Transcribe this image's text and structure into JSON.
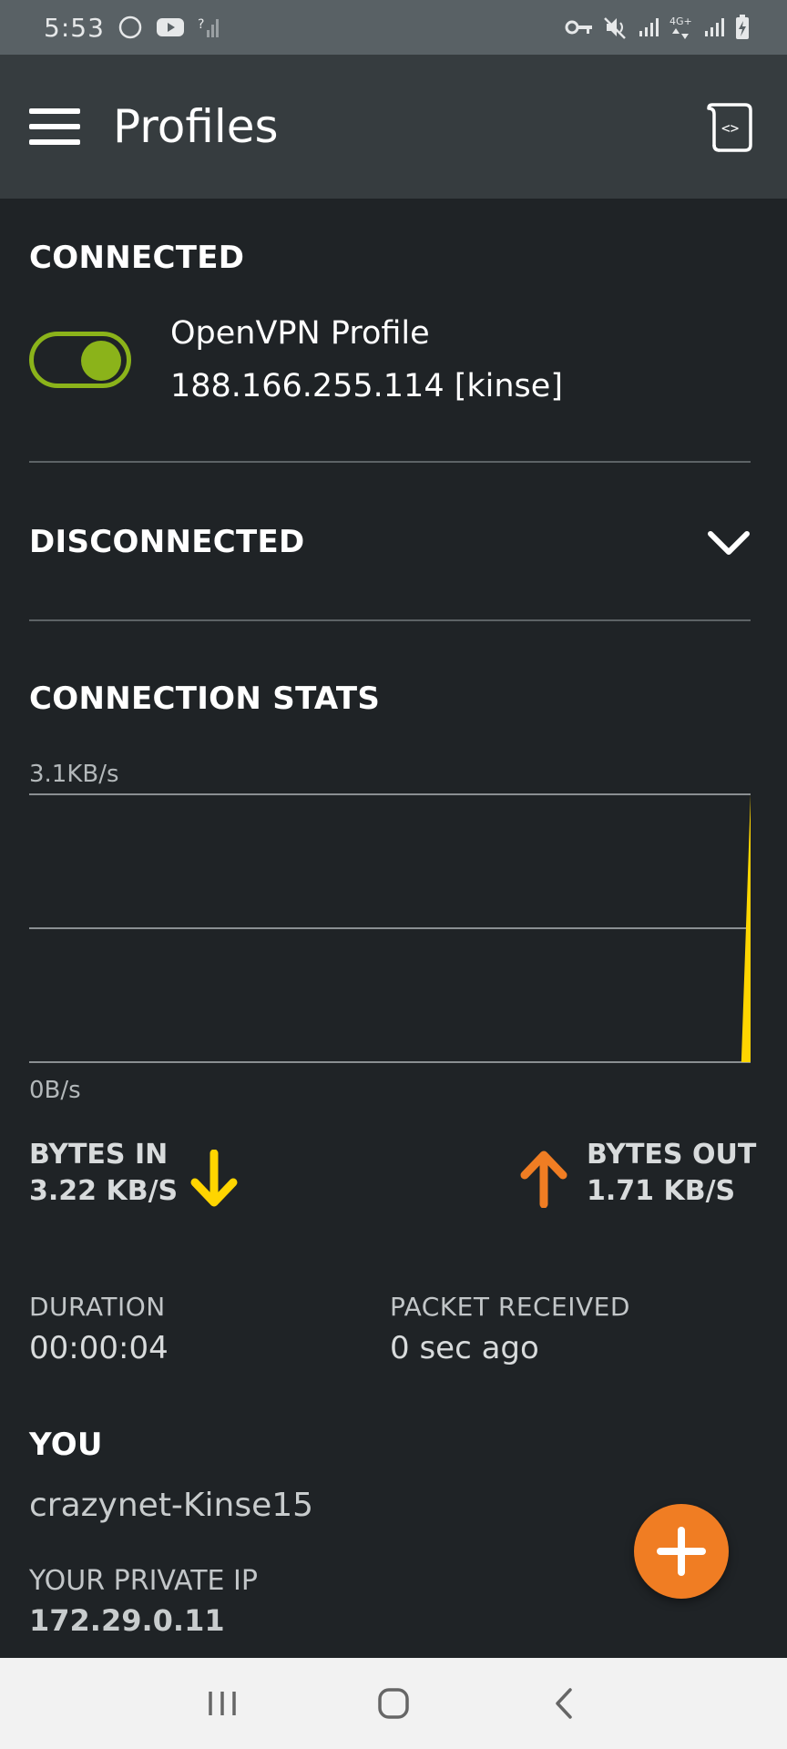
{
  "status_bar": {
    "time": "5:53",
    "left_icons": [
      "circle-icon",
      "youtube-icon",
      "signal-unknown-icon"
    ],
    "right_icons": [
      "vpn-key-icon",
      "mute-icon",
      "signal-icon",
      "data-4g-icon",
      "signal-icon",
      "battery-charging-icon"
    ],
    "network_label": "4G+"
  },
  "app_bar": {
    "title": "Profiles",
    "menu_icon": "hamburger-menu-icon",
    "action_icon": "import-profile-icon"
  },
  "connected_section": {
    "header": "CONNECTED",
    "profile": {
      "name": "OpenVPN Profile",
      "address": "188.166.255.114 [kinse]",
      "enabled": true
    }
  },
  "disconnected_section": {
    "header": "DISCONNECTED",
    "expand_icon": "chevron-down-icon"
  },
  "stats_section": {
    "header": "CONNECTION STATS",
    "bytes_in_label": "BYTES IN",
    "bytes_in_value": "3.22 KB/S",
    "bytes_out_label": "BYTES OUT",
    "bytes_out_value": "1.71 KB/S",
    "duration_label": "DURATION",
    "duration_value": "00:00:04",
    "packet_label": "PACKET RECEIVED",
    "packet_value": "0 sec ago"
  },
  "chart_data": {
    "type": "area",
    "title": "",
    "ylim_labels": {
      "top": "3.1KB/s",
      "bottom": "0B/s"
    },
    "ylim": [
      0,
      3.1
    ],
    "series": [
      {
        "name": "bytes-in",
        "color": "#ffd500",
        "values": [
          0,
          0,
          0,
          0,
          0,
          0,
          0,
          0,
          0,
          0,
          0,
          0,
          0,
          0,
          0,
          0,
          0,
          0,
          0,
          0,
          0,
          0,
          0,
          0,
          0,
          0,
          0,
          0,
          0,
          0,
          0,
          0,
          0,
          0,
          0,
          0,
          0,
          0,
          0,
          0,
          0,
          0,
          0,
          0,
          0,
          0,
          0,
          0,
          0,
          0,
          0,
          0,
          0,
          0,
          0,
          0,
          0,
          0,
          0,
          0,
          0,
          0,
          0,
          0,
          0,
          0,
          0,
          0,
          0,
          0,
          0,
          0,
          0,
          0,
          0,
          0,
          0,
          0,
          3.1
        ]
      }
    ],
    "grid": true
  },
  "you_section": {
    "header": "YOU",
    "name": "crazynet-Kinse15",
    "private_ip_label": "YOUR PRIVATE IP",
    "private_ip_value": "172.29.0.11"
  },
  "fab": {
    "icon": "plus-icon"
  },
  "colors": {
    "background": "#1f2326",
    "app_bar": "#363c3f",
    "toggle_green": "#8bb31a",
    "bytes_in_yellow": "#ffd500",
    "bytes_out_orange": "#f07d23",
    "fab_orange": "#f07d23"
  },
  "nav_bar": {
    "icons": [
      "recents-icon",
      "home-icon",
      "back-icon"
    ]
  }
}
